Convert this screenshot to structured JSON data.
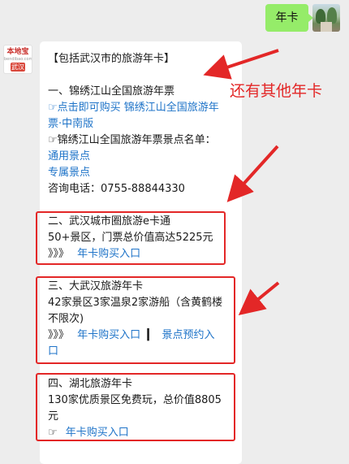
{
  "user_message": {
    "text": "年卡"
  },
  "bot_avatar": {
    "logo": "本地宝",
    "site": "bendibao.com",
    "city": "武汉"
  },
  "card": {
    "header": "【包括武汉市的旅游年卡】",
    "section1": {
      "title": "一、锦绣江山全国旅游年票",
      "buy_line1": "☞点击即可购买 锦绣江山全国旅游年",
      "buy_line2": "票·中南版",
      "scenic_list_line": "☞锦绣江山全国旅游年票景点名单：",
      "general_link": "通用景点",
      "exclusive_link": "专属景点",
      "phone": "咨询电话：0755-88844330"
    },
    "section2": {
      "title": "二、武汉城市圈旅游e卡通",
      "desc": "50+景区，门票总价值高达5225元",
      "arrows": "》》》",
      "buy_link": "年卡购买入口"
    },
    "section3": {
      "title": "三、大武汉旅游年卡",
      "desc_line1": "42家景区3家温泉2家游船（含黄鹤楼",
      "desc_line2": "不限次)",
      "arrows": "》》》",
      "buy_link": "年卡购买入口",
      "separator": "▎",
      "booking_link_part1": "景点预约入",
      "booking_link_part2": "口"
    },
    "section4": {
      "title": "四、湖北旅游年卡",
      "desc_line1": "130家优质景区免费玩，总价值8805",
      "desc_line2": "元",
      "pointer": "☞",
      "buy_link": "年卡购买入口"
    }
  },
  "annotation": {
    "text": "还有其他年卡",
    "color": "#e32727"
  }
}
